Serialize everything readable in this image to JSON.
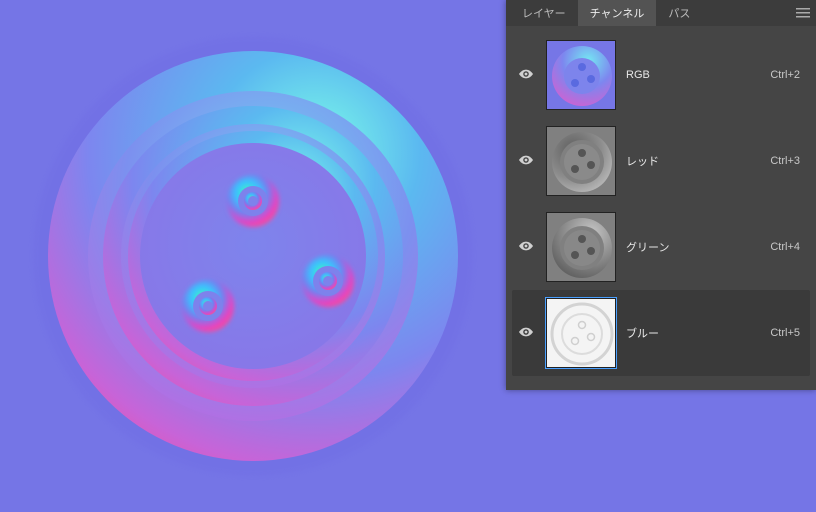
{
  "panel": {
    "tabs": [
      {
        "label": "レイヤー",
        "active": false
      },
      {
        "label": "チャンネル",
        "active": true
      },
      {
        "label": "パス",
        "active": false
      }
    ]
  },
  "channels": [
    {
      "name": "RGB",
      "shortcut": "Ctrl+2",
      "visible": true,
      "kind": "rgb",
      "selected": false
    },
    {
      "name": "レッド",
      "shortcut": "Ctrl+3",
      "visible": true,
      "kind": "gray",
      "selected": false
    },
    {
      "name": "グリーン",
      "shortcut": "Ctrl+4",
      "visible": true,
      "kind": "gray",
      "selected": false
    },
    {
      "name": "ブルー",
      "shortcut": "Ctrl+5",
      "visible": true,
      "kind": "light",
      "selected": true
    }
  ]
}
